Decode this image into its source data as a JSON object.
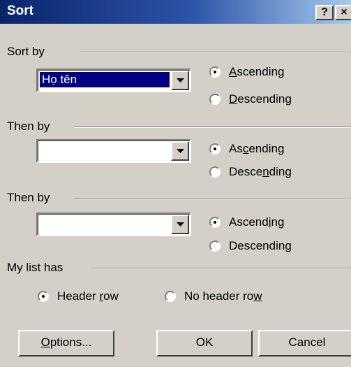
{
  "window": {
    "title": "Sort",
    "help_glyph": "?",
    "close_glyph": "×"
  },
  "sort_by": {
    "label": "Sort by",
    "combo_value": "Họ tên",
    "ascending": {
      "pre": "",
      "key": "A",
      "post": "scending",
      "selected": true
    },
    "descending": {
      "pre": "",
      "key": "D",
      "post": "escending",
      "selected": false
    }
  },
  "then_by_1": {
    "label": "Then by",
    "combo_value": "",
    "ascending": {
      "pre": "As",
      "key": "c",
      "post": "ending",
      "selected": true
    },
    "descending": {
      "pre": "Desce",
      "key": "n",
      "post": "ding",
      "selected": false
    }
  },
  "then_by_2": {
    "label": "Then by",
    "combo_value": "",
    "ascending": {
      "pre": "Ascend",
      "key": "i",
      "post": "ng",
      "selected": true
    },
    "descending": {
      "pre": "Descendin",
      "key": "g",
      "post": "",
      "selected": false
    }
  },
  "my_list_has": {
    "label": "My list has",
    "header_row": {
      "pre": "Header ",
      "key": "r",
      "post": "ow",
      "selected": true
    },
    "no_header_row": {
      "pre": "No header ro",
      "key": "w",
      "post": "",
      "selected": false
    }
  },
  "buttons": {
    "options": {
      "pre": "",
      "key": "O",
      "post": "ptions..."
    },
    "ok": "OK",
    "cancel": "Cancel"
  }
}
